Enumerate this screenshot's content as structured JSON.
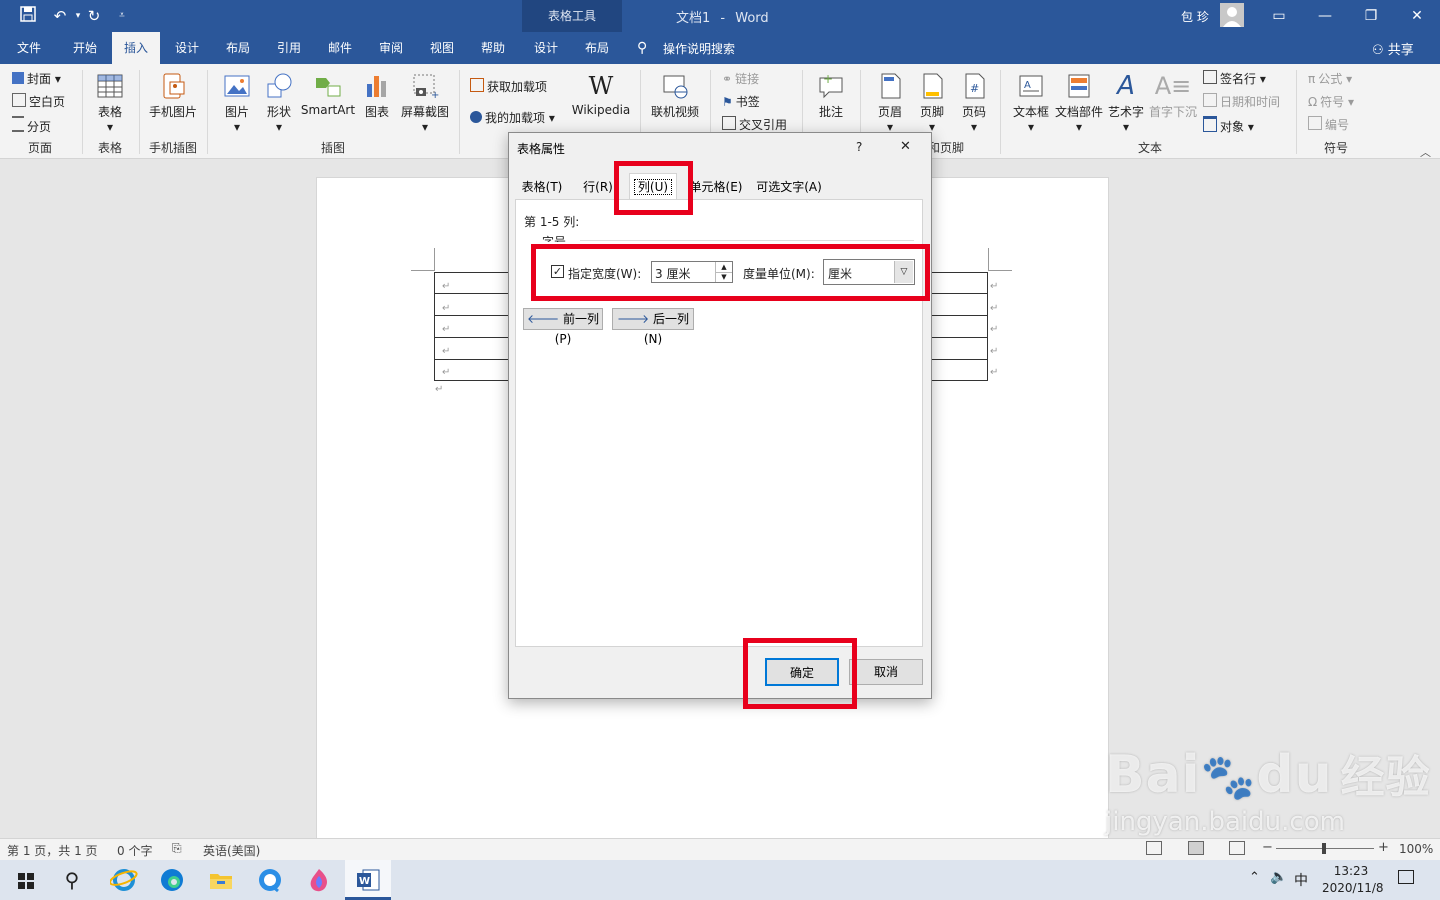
{
  "window": {
    "context_tab": "表格工具",
    "doc_title": "文档1",
    "separator": "-",
    "app_name": "Word",
    "user_name": "包 珍"
  },
  "tabs": [
    "文件",
    "开始",
    "插入",
    "设计",
    "布局",
    "引用",
    "邮件",
    "审阅",
    "视图",
    "帮助",
    "设计",
    "布局"
  ],
  "search_label": "操作说明搜索",
  "share_label": "共享",
  "ribbon": {
    "pages": {
      "cover": "封面",
      "blank": "空白页",
      "break": "分页",
      "label": "页面"
    },
    "table": {
      "btn": "表格",
      "label": "表格"
    },
    "phone": {
      "btn": "手机图片",
      "label": "手机插图"
    },
    "illus": {
      "picture": "图片",
      "shapes": "形状",
      "smartart": "SmartArt",
      "chart": "图表",
      "screenshot": "屏幕截图",
      "label": "插图"
    },
    "addins": {
      "get": "获取加载项",
      "mine": "我的加载项",
      "wiki": "Wikipedia",
      "wiki_glyph": "W"
    },
    "media": {
      "video": "联机视频"
    },
    "links": {
      "link": "链接",
      "bookmark": "书签",
      "crossref": "交叉引用"
    },
    "comments": {
      "comment": "批注"
    },
    "header": {
      "header": "页眉",
      "footer": "页脚",
      "pagenum": "页码",
      "label_partial": "和页脚"
    },
    "text": {
      "textbox": "文本框",
      "parts": "文档部件",
      "wordart": "艺术字",
      "dropcap": "首字下沉",
      "sigline": "签名行",
      "datetime": "日期和时间",
      "object": "对象",
      "label": "文本"
    },
    "symbols": {
      "equation": "公式",
      "symbol": "符号",
      "number": "编号",
      "label": "符号"
    }
  },
  "dialog": {
    "title": "表格属性",
    "help": "?",
    "close": "✕",
    "tabs": [
      "表格(T)",
      "行(R)",
      "列(U)",
      "单元格(E)",
      "可选文字(A)"
    ],
    "column_range": "第 1-5 列:",
    "size_label": "字号",
    "width_checkbox_label": "指定宽度(W):",
    "width_checked": true,
    "width_value": "3 厘米",
    "unit_label": "度量单位(M):",
    "unit_value": "厘米",
    "prev_col": "前一列(P)",
    "next_col": "后一列(N)",
    "ok": "确定",
    "cancel": "取消"
  },
  "status": {
    "page": "第 1 页，共 1 页",
    "words": "0 个字",
    "lang": "英语(美国)",
    "zoom": "100%",
    "zoom_minus": "−",
    "zoom_plus": "+"
  },
  "taskbar": {
    "ime": "中",
    "time": "13:23",
    "date": "2020/11/8"
  },
  "watermark": {
    "line1": "Bai",
    "line2": "du",
    "line3": "经验",
    "url": "jingyan.baidu.com"
  },
  "colors": {
    "brand": "#2b579a",
    "highlight": "#e8001c"
  }
}
